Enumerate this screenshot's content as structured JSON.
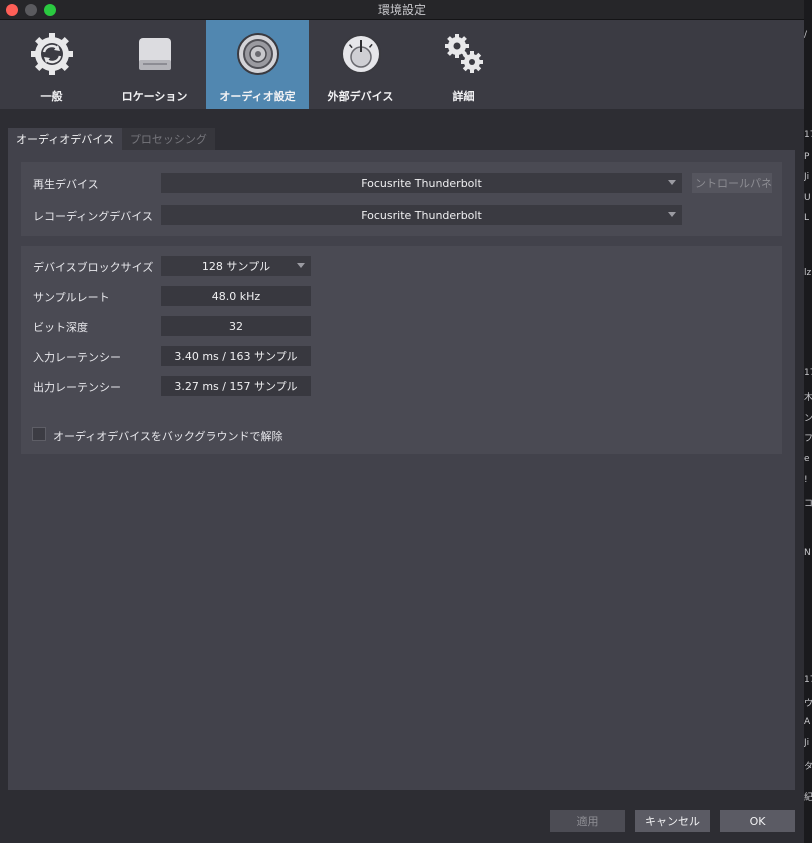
{
  "window": {
    "title": "環境設定"
  },
  "toolbar": {
    "items": [
      {
        "label": "一般",
        "icon": "sync-gear-icon"
      },
      {
        "label": "ロケーション",
        "icon": "hard-drive-icon"
      },
      {
        "label": "オーディオ設定",
        "icon": "speaker-icon",
        "active": true
      },
      {
        "label": "外部デバイス",
        "icon": "dial-icon"
      },
      {
        "label": "詳細",
        "icon": "gears-icon"
      }
    ]
  },
  "tabs": [
    {
      "label": "オーディオデバイス",
      "active": true
    },
    {
      "label": "プロセッシング",
      "active": false
    }
  ],
  "devices": {
    "playback_label": "再生デバイス",
    "playback_value": "Focusrite Thunderbolt",
    "control_panel_label": "ントロールパネ",
    "recording_label": "レコーディングデバイス",
    "recording_value": "Focusrite Thunderbolt"
  },
  "settings": {
    "block_size_label": "デバイスブロックサイズ",
    "block_size_value": "128 サンプル",
    "sample_rate_label": "サンプルレート",
    "sample_rate_value": "48.0 kHz",
    "bit_depth_label": "ビット深度",
    "bit_depth_value": "32",
    "input_latency_label": "入力レーテンシー",
    "input_latency_value": "3.40 ms / 163 サンプル",
    "output_latency_label": "出力レーテンシー",
    "output_latency_value": "3.27 ms / 157 サンプル",
    "release_bg_label": "オーディオデバイスをバックグラウンドで解除",
    "release_bg_checked": false
  },
  "buttons": {
    "apply": "適用",
    "cancel": "キャンセル",
    "ok": "OK"
  },
  "edge_fragments": [
    "/",
    "17",
    "P",
    "Ji",
    "U",
    "L",
    "lz",
    "17",
    "木",
    "ン",
    "フ",
    "e",
    "!",
    "コ",
    "N",
    "17",
    "ウ",
    "A",
    "Ji",
    "タ",
    "紀"
  ],
  "colors": {
    "active_tab_accent": "#5187b0",
    "toolbar_bg": "#3b3b43",
    "panel_bg": "#42424b"
  }
}
